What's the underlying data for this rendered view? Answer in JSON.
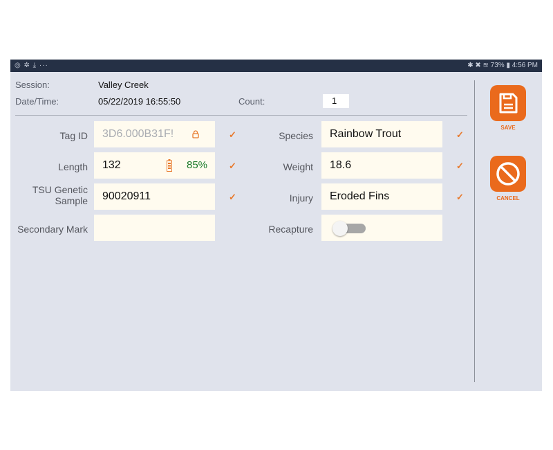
{
  "status_bar": {
    "left_icons": "◎ ✲ ⤓ ···",
    "right_text": "✱ ✖ ≋ 73% ▮ 4:56 PM"
  },
  "header": {
    "session_label": "Session:",
    "session_value": "Valley Creek",
    "datetime_label": "Date/Time:",
    "datetime_value": "05/22/2019 16:55:50",
    "count_label": "Count:",
    "count_value": "1"
  },
  "fields": {
    "tag_id": {
      "label": "Tag ID",
      "value": "3D6.000B31F!",
      "check": "✓"
    },
    "length": {
      "label": "Length",
      "value": "132",
      "battery_percent": "85%",
      "check": "✓"
    },
    "tsu_genetic": {
      "label_line1": "TSU Genetic",
      "label_line2": "Sample",
      "value": "90020911",
      "check": "✓"
    },
    "secondary_mark": {
      "label": "Secondary Mark",
      "value": ""
    },
    "species": {
      "label": "Species",
      "value": "Rainbow Trout",
      "check": "✓"
    },
    "weight": {
      "label": "Weight",
      "value": "18.6",
      "check": "✓"
    },
    "injury": {
      "label": "Injury",
      "value": "Eroded Fins",
      "check": "✓"
    },
    "recapture": {
      "label": "Recapture",
      "on": false
    }
  },
  "actions": {
    "save_label": "SAVE",
    "cancel_label": "CANCEL"
  },
  "colors": {
    "accent": "#ea6a1c",
    "status_bar": "#253045",
    "background": "#e0e3ec",
    "field_bg": "#fffbef"
  }
}
